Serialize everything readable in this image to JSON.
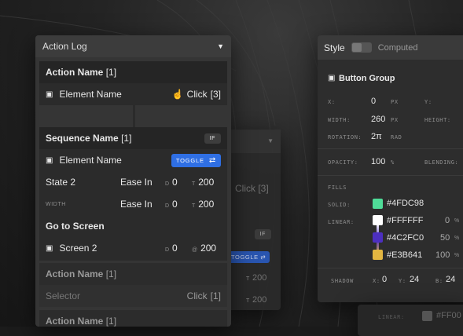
{
  "action_log": {
    "title": "Action Log",
    "card1": {
      "name": "Action Name",
      "index": "[1]",
      "element": "Element Name",
      "trigger": "Click",
      "trigger_count": "[3]"
    },
    "sequence": {
      "name": "Sequence Name",
      "index": "[1]",
      "badge": "IF",
      "element": "Element Name",
      "toggle_label": "TOGGLE",
      "rows": [
        {
          "label": "State 2",
          "easing": "Ease In",
          "d_label": "D",
          "d": "0",
          "t_label": "T",
          "t": "200"
        },
        {
          "label": "WIDTH",
          "easing": "Ease In",
          "d_label": "D",
          "d": "0",
          "t_label": "T",
          "t": "200"
        }
      ]
    },
    "goto": {
      "title": "Go to Screen",
      "screen": "Screen 2",
      "d_label": "D",
      "d": "0",
      "at_label": "@",
      "at": "200"
    },
    "card3": {
      "name": "Action Name",
      "index": "[1]",
      "selector": "Selector",
      "trigger": "Click",
      "trigger_count": "[1]"
    },
    "card4": {
      "name": "Action Name",
      "index": "[1]"
    }
  },
  "ghost_panel": {
    "click": "Click",
    "click_count": "[3]",
    "if": "IF",
    "toggle": "TOGGLE",
    "t1_label": "T",
    "t1": "200",
    "t2_label": "T",
    "t2": "200"
  },
  "style_panel": {
    "title": "Style",
    "computed": "Computed",
    "section": "Button Group",
    "x_label": "X:",
    "x": "0",
    "x_unit": "PX",
    "y_label": "Y:",
    "width_label": "WIDTH:",
    "width": "260",
    "width_unit": "PX",
    "height_label": "HEIGHT:",
    "rotation_label": "ROTATION:",
    "rotation": "2π",
    "rotation_unit": "RAD",
    "opacity_label": "OPACITY:",
    "opacity": "100",
    "opacity_unit": "%",
    "blending_label": "BLENDING:",
    "fills_label": "FILLS",
    "solid_label": "SOLID:",
    "solid_hex": "#4FDC98",
    "linear_label": "LINEAR:",
    "linear_stops": [
      {
        "hex": "#FFFFFF",
        "pct": "0",
        "unit": "%"
      },
      {
        "hex": "#4C2FC0",
        "pct": "50",
        "unit": "%"
      },
      {
        "hex": "#E3B641",
        "pct": "100",
        "unit": "%"
      }
    ],
    "shadow_label": "SHADOW",
    "sx_label": "X:",
    "sx": "0",
    "sy_label": "Y:",
    "sy": "24",
    "sb_label": "B:",
    "sb": "24",
    "bottom_linear_label": "LINEAR:",
    "bottom_hex": "#FF00"
  },
  "colors": {
    "accent": "#2F6FE4",
    "solid": "#4FDC98",
    "stop1": "#FFFFFF",
    "stop2": "#4C2FC0",
    "stop3": "#E3B641"
  }
}
